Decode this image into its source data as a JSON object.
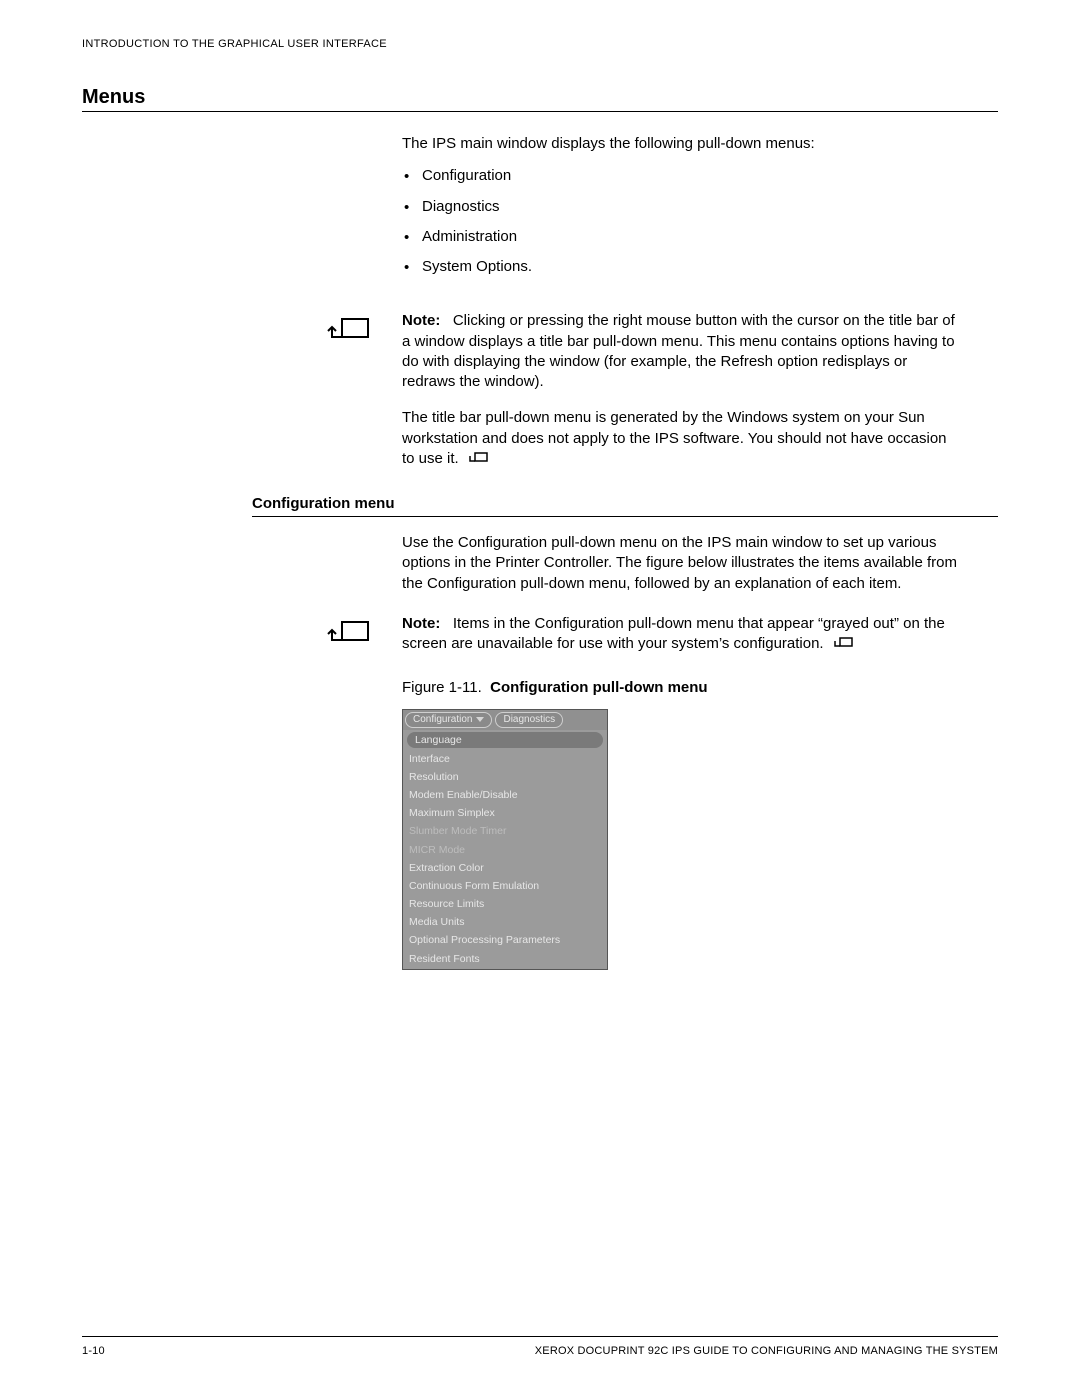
{
  "header": {
    "running": "INTRODUCTION TO THE GRAPHICAL USER INTERFACE"
  },
  "section": {
    "title": "Menus"
  },
  "intro": "The IPS main window displays the following pull-down menus:",
  "bullets": [
    "Configuration",
    "Diagnostics",
    "Administration",
    "System Options."
  ],
  "note1": {
    "label": "Note:",
    "body": "Clicking or pressing the right mouse button with the cursor on the title bar of a window displays a title bar pull-down menu. This menu contains options having to do with displaying the window (for example, the Refresh option redisplays or redraws the window)."
  },
  "note1_p2": "The title bar pull-down menu is generated by the Windows system on your Sun workstation and does not apply to the IPS software. You should not have occasion to use it.",
  "subsection": {
    "title": "Configuration menu"
  },
  "config_intro": "Use the Configuration pull-down menu on the IPS main window to set up various options in the Printer Controller. The figure below illustrates the items available from the Configuration pull-down menu, followed by an explanation of each item.",
  "note2": {
    "label": "Note:",
    "body": "Items in the Configuration pull-down menu that appear “grayed out” on the screen are unavailable for use with your system’s configuration."
  },
  "figure": {
    "caption_label": "Figure 1-11.",
    "caption_title": "Configuration pull-down menu",
    "toolbar": {
      "btn1": "Configuration",
      "btn2": "Diagnostics"
    },
    "items": [
      {
        "label": "Language",
        "style": "hl"
      },
      {
        "label": "Interface",
        "style": ""
      },
      {
        "label": "Resolution",
        "style": ""
      },
      {
        "label": "Modem Enable/Disable",
        "style": ""
      },
      {
        "label": "Maximum Simplex",
        "style": ""
      },
      {
        "label": "Slumber Mode Timer",
        "style": "greyed"
      },
      {
        "label": "MICR Mode",
        "style": "greyed"
      },
      {
        "label": "Extraction Color",
        "style": ""
      },
      {
        "label": "Continuous Form Emulation",
        "style": ""
      },
      {
        "label": "Resource Limits",
        "style": ""
      },
      {
        "label": "Media Units",
        "style": ""
      },
      {
        "label": "Optional Processing Parameters",
        "style": ""
      },
      {
        "label": "Resident Fonts",
        "style": ""
      }
    ]
  },
  "footer": {
    "page": "1-10",
    "doc": "XEROX DOCUPRINT 92C IPS GUIDE TO CONFIGURING AND MANAGING THE SYSTEM"
  }
}
